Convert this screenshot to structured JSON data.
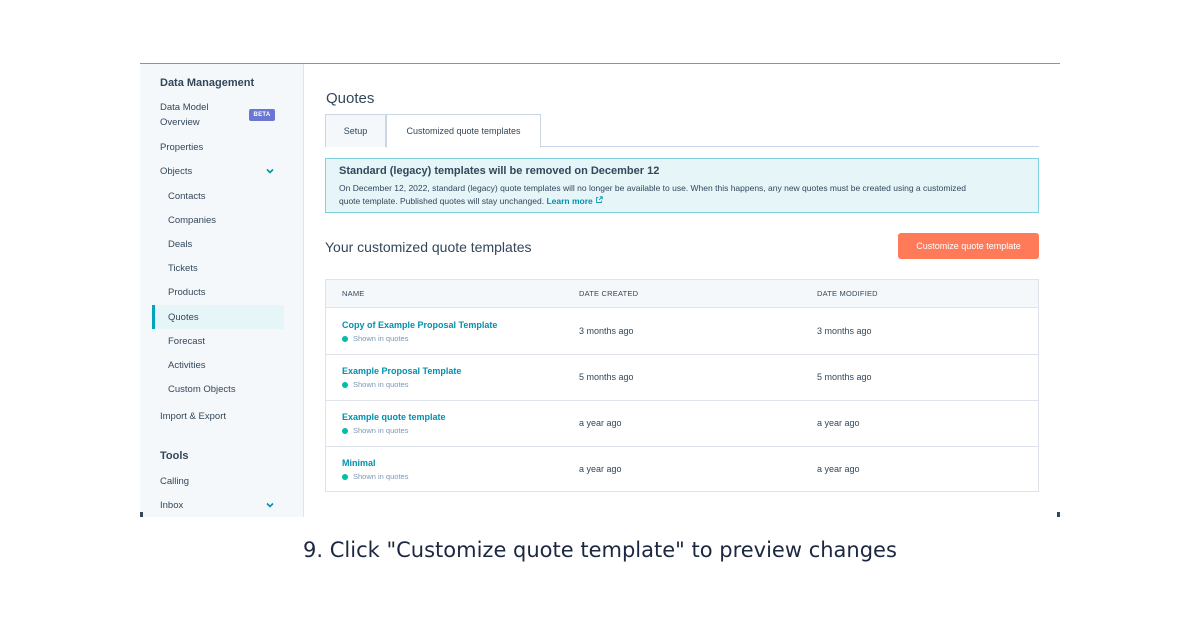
{
  "sidebar": {
    "heading_data_management": "Data Management",
    "data_model_line1": "Data Model",
    "data_model_line2": "Overview",
    "beta_badge": "BETA",
    "properties": "Properties",
    "objects": "Objects",
    "contacts": "Contacts",
    "companies": "Companies",
    "deals": "Deals",
    "tickets": "Tickets",
    "products": "Products",
    "quotes": "Quotes",
    "forecast": "Forecast",
    "activities": "Activities",
    "custom_objects": "Custom Objects",
    "import_export": "Import & Export",
    "heading_tools": "Tools",
    "calling": "Calling",
    "inbox": "Inbox"
  },
  "page": {
    "title": "Quotes",
    "tabs": [
      {
        "label": "Setup"
      },
      {
        "label": "Customized quote templates"
      }
    ]
  },
  "alert": {
    "title": "Standard (legacy) templates will be removed on December 12",
    "body_line1": "On December 12, 2022, standard (legacy) quote templates will no longer be available to use. When this happens, any new quotes must be created using a customized",
    "body_line2": "quote template. Published quotes will stay unchanged.",
    "link": "Learn more"
  },
  "section": {
    "title": "Your customized quote templates",
    "customize_button": "Customize quote template"
  },
  "table": {
    "columns": [
      "NAME",
      "DATE CREATED",
      "DATE MODIFIED"
    ],
    "rows": [
      {
        "name": "Copy of Example Proposal Template",
        "status": "Shown in quotes",
        "created": "3 months ago",
        "modified": "3 months ago"
      },
      {
        "name": "Example Proposal Template",
        "status": "Shown in quotes",
        "created": "5 months ago",
        "modified": "5 months ago"
      },
      {
        "name": "Example quote template",
        "status": "Shown in quotes",
        "created": "a year ago",
        "modified": "a year ago"
      },
      {
        "name": "Minimal",
        "status": "Shown in quotes",
        "created": "a year ago",
        "modified": "a year ago"
      }
    ]
  },
  "caption": "9. Click \"Customize quote template\" to preview changes",
  "colors": {
    "accent": "#ff7a59",
    "link": "#0091ae",
    "beta": "#6a78d1",
    "status_dot": "#00bda5",
    "alert_bg": "#e5f5f8"
  },
  "icons": [
    "chevron-down-icon",
    "external-link-icon",
    "status-dot-icon"
  ]
}
